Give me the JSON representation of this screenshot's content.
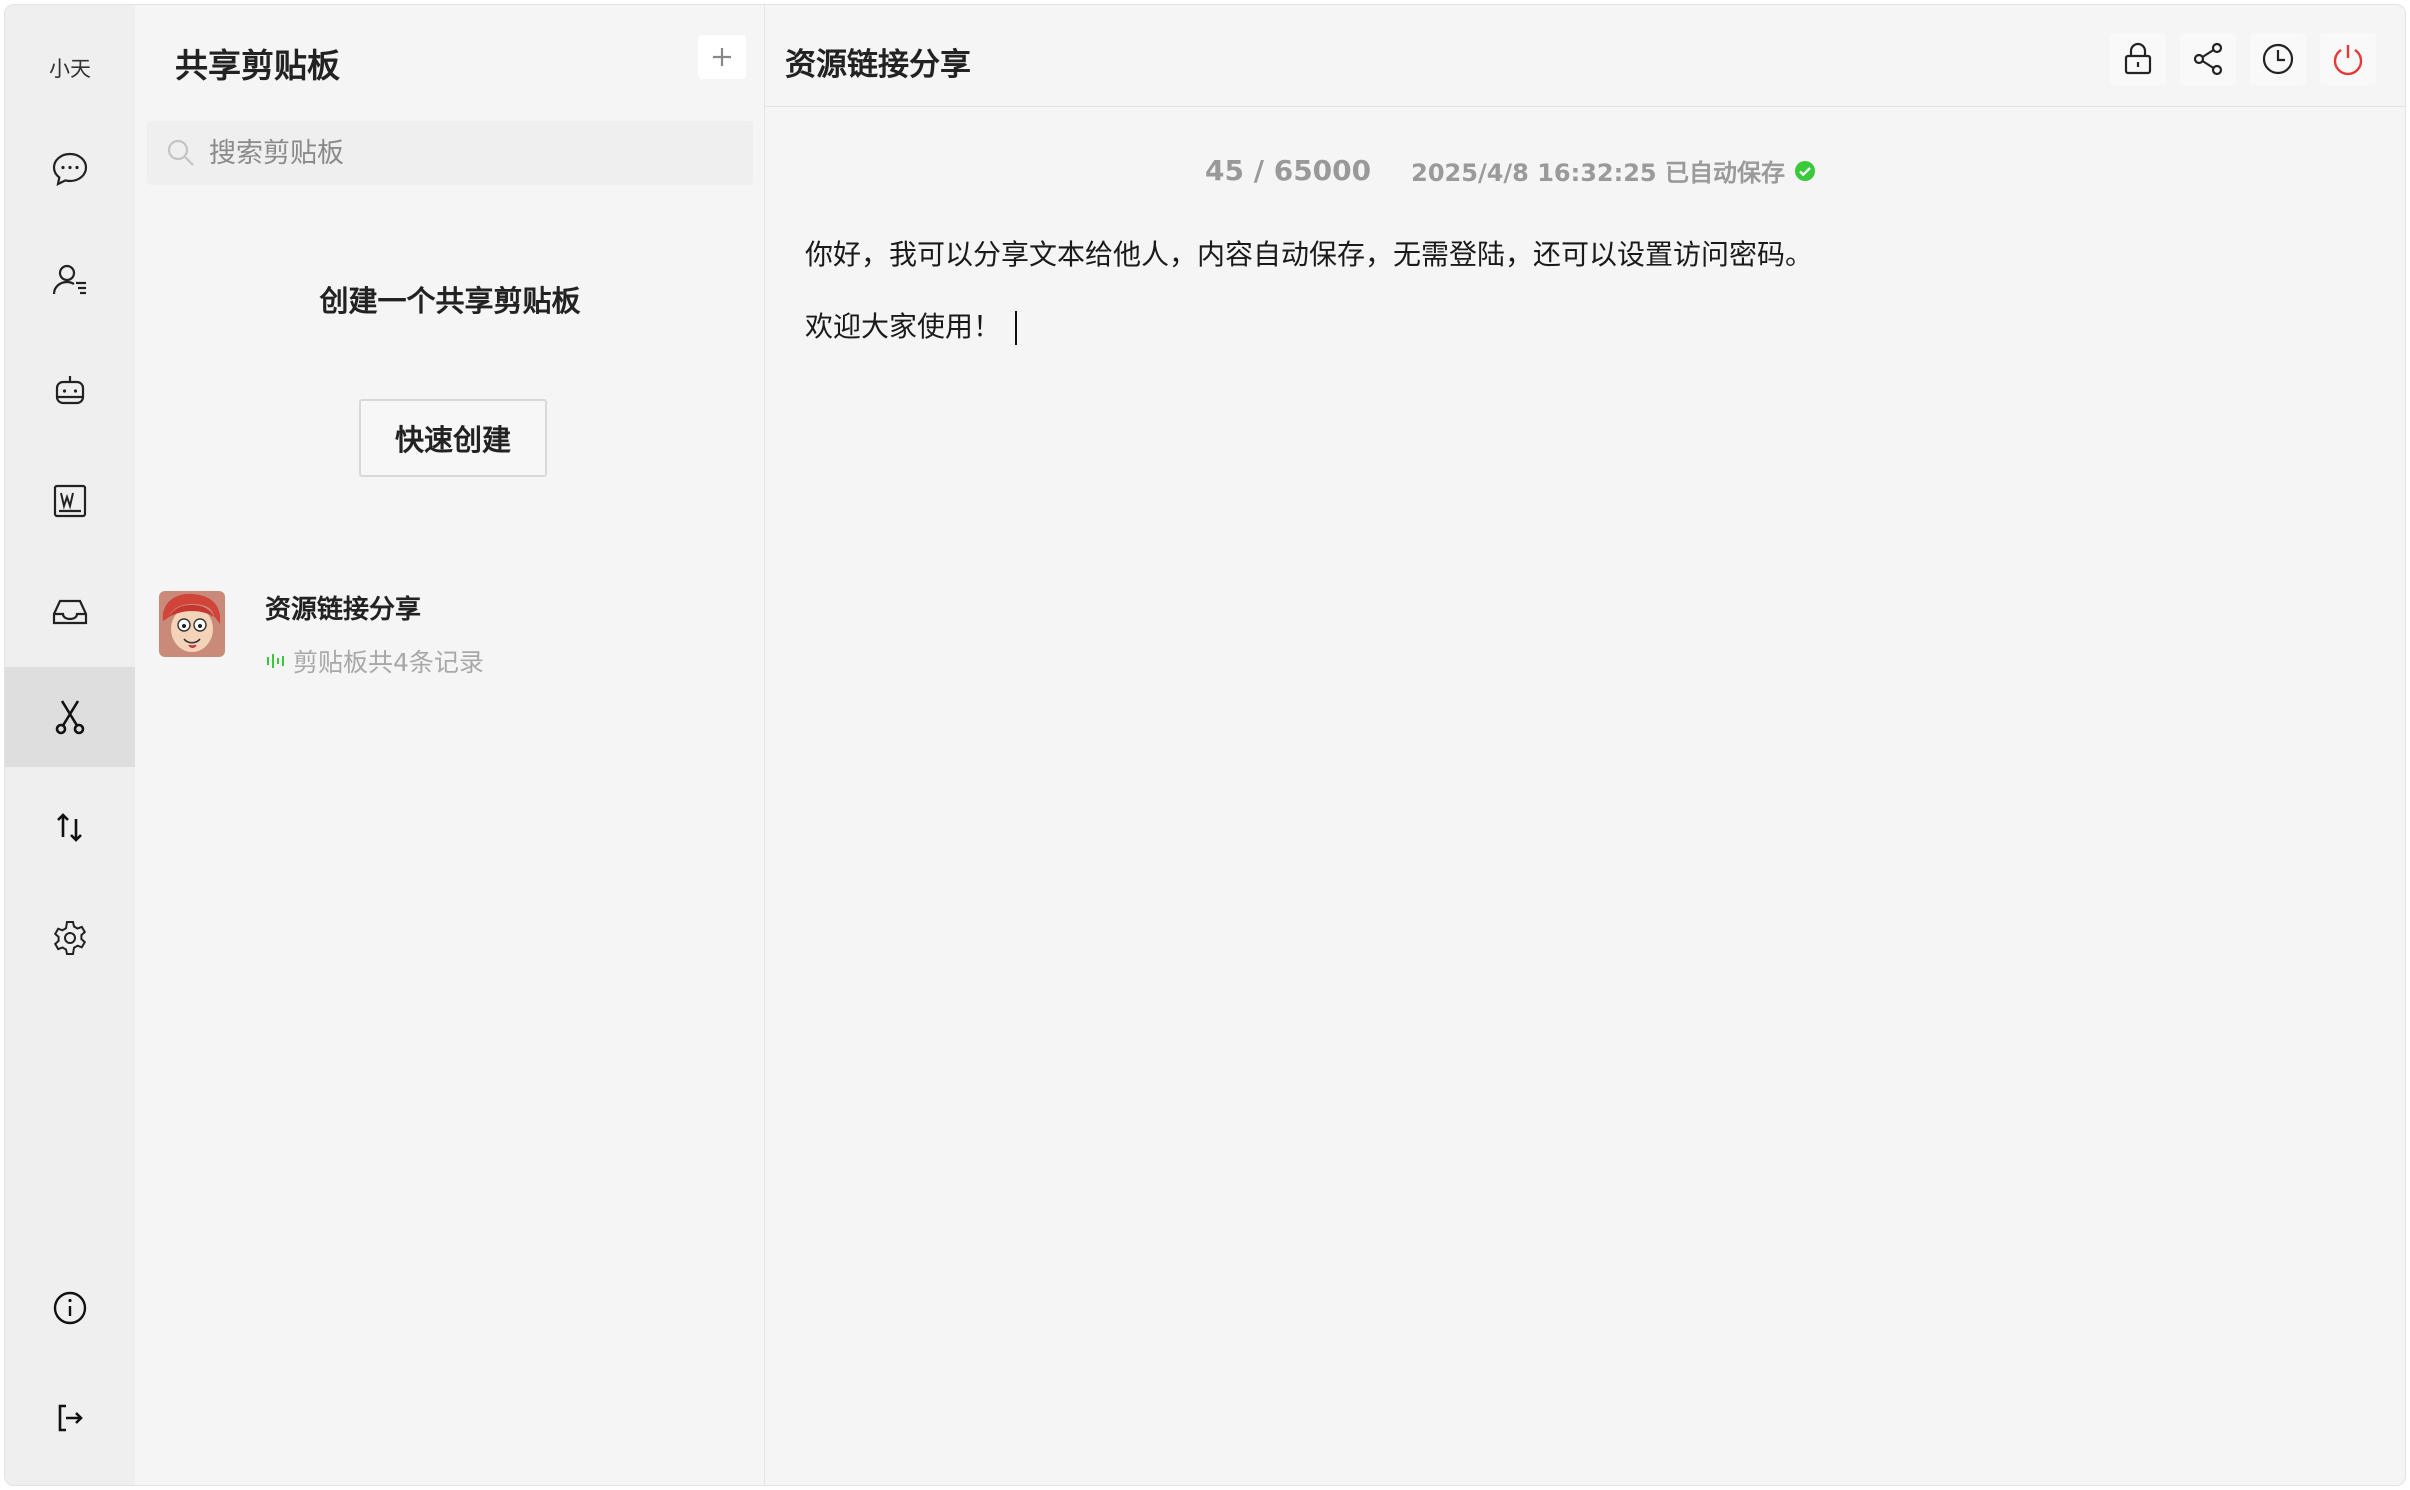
{
  "user": {
    "name": "小天"
  },
  "sidebar": {
    "items": [
      {
        "icon": "chat-bubble-icon"
      },
      {
        "icon": "contacts-icon"
      },
      {
        "icon": "robot-icon"
      },
      {
        "icon": "word-doc-icon"
      },
      {
        "icon": "inbox-icon"
      },
      {
        "icon": "scissors-icon",
        "active": true
      },
      {
        "icon": "transfer-arrows-icon"
      },
      {
        "icon": "settings-gear-icon"
      }
    ],
    "bottom_items": [
      {
        "icon": "info-icon"
      },
      {
        "icon": "logout-icon"
      }
    ]
  },
  "list_panel": {
    "title": "共享剪贴板",
    "add_button_icon": "plus-icon",
    "search_placeholder": "搜索剪贴板",
    "empty_title": "创建一个共享剪贴板",
    "quick_create_label": "快速创建",
    "items": [
      {
        "title": "资源链接分享",
        "subtitle": "剪贴板共4条记录"
      }
    ]
  },
  "main": {
    "title": "资源链接分享",
    "toolbar": [
      "lock-icon",
      "share-icon",
      "history-clock-icon",
      "power-icon"
    ],
    "char_count": "45 / 65000",
    "save_status": "2025/4/8 16:32:25 已自动保存",
    "content": {
      "line1": "你好，我可以分享文本给他人，内容自动保存，无需登陆，还可以设置访问密码。",
      "line2": "欢迎大家使用！"
    }
  },
  "colors": {
    "accent_green": "#3ac93a",
    "power_red": "#e53935",
    "active_rail_bg": "#dedede"
  }
}
